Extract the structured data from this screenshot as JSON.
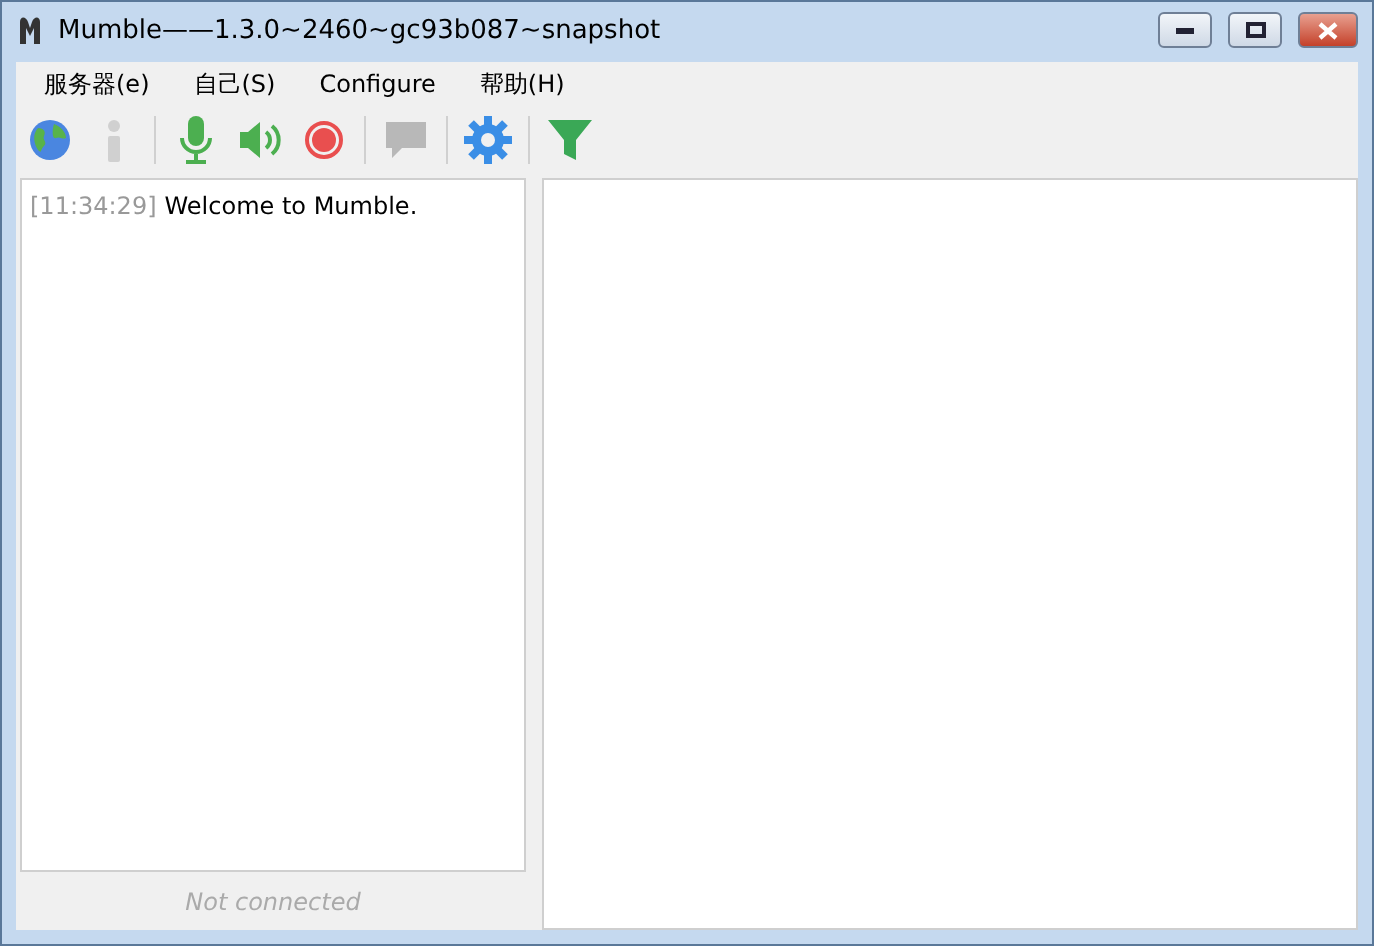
{
  "window": {
    "title": "Mumble——1.3.0~2460~gc93b087~snapshot"
  },
  "menu": [
    {
      "label": "服务器(e)"
    },
    {
      "label": "自己(S)"
    },
    {
      "label": "Configure"
    },
    {
      "label": "帮助(H)"
    }
  ],
  "toolbar": [
    {
      "kind": "globe",
      "disabled": false
    },
    {
      "kind": "info",
      "disabled": true
    },
    {
      "kind": "separator"
    },
    {
      "kind": "mic",
      "disabled": false
    },
    {
      "kind": "speaker",
      "disabled": false
    },
    {
      "kind": "record",
      "disabled": false
    },
    {
      "kind": "separator"
    },
    {
      "kind": "chat",
      "disabled": true
    },
    {
      "kind": "separator"
    },
    {
      "kind": "settings",
      "disabled": false
    },
    {
      "kind": "separator"
    },
    {
      "kind": "filter",
      "disabled": false
    }
  ],
  "log": [
    {
      "time": "[11:34:29]",
      "message": "Welcome to Mumble."
    }
  ],
  "status": "Not connected"
}
